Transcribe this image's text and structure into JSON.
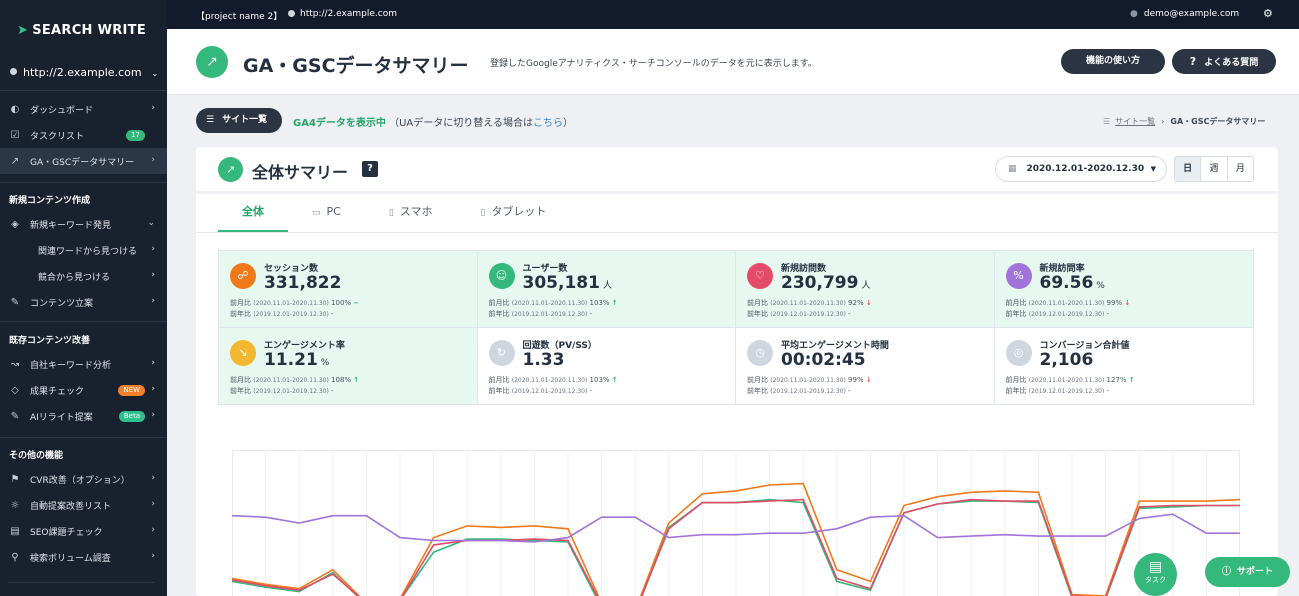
{
  "app": {
    "logo": "SEARCH WRITE",
    "site": "http://2.example.com"
  },
  "topbar": {
    "project": "【project name 2】",
    "url": "http://2.example.com",
    "user": "demo@example.com"
  },
  "sidebar": {
    "items_top": [
      {
        "label": "ダッシュボード",
        "icon": "gauge-icon"
      },
      {
        "label": "タスクリスト",
        "icon": "checkbox-icon",
        "badge": "17"
      },
      {
        "label": "GA・GSCデータサマリー",
        "icon": "chart-line-icon",
        "active": true
      }
    ],
    "sec_new": "新規コンテンツ作成",
    "new_items": [
      {
        "label": "新規キーワード発見"
      },
      {
        "label": "関連ワードから見つける"
      },
      {
        "label": "競合から見つける"
      },
      {
        "label": "コンテンツ立案"
      }
    ],
    "sec_existing": "既存コンテンツ改善",
    "existing_items": [
      {
        "label": "自社キーワード分析"
      },
      {
        "label": "成果チェック",
        "badge": "NEW"
      },
      {
        "label": "AIリライト提案",
        "badge": "Beta"
      }
    ],
    "sec_other": "その他の機能",
    "other_items": [
      {
        "label": "CVR改善（オプション）"
      },
      {
        "label": "自動提案改善リスト"
      },
      {
        "label": "SEO課題チェック"
      },
      {
        "label": "検索ボリューム調査"
      }
    ]
  },
  "header": {
    "title": "GA・GSCデータサマリー",
    "desc": "登録したGoogleアナリティクス・サーチコンソールのデータを元に表示します。",
    "btn_usage": "機能の使い方",
    "btn_faq": "よくある質問"
  },
  "toolbar": {
    "site_list": "サイト一覧",
    "ga4_on": "GA4データを表示中",
    "ga4_note_pre": "（UAデータに切り替える場合は",
    "ga4_link": "こちら",
    "ga4_note_post": "）",
    "crumb_link": "サイト一覧",
    "crumb_sep": "›",
    "crumb_current": "GA・GSCデータサマリー"
  },
  "summary": {
    "title": "全体サマリー",
    "help": "?",
    "date_range": "2020.12.01-2020.12.30",
    "periods": [
      "日",
      "週",
      "月"
    ],
    "tabs": [
      "全体",
      "PC",
      "スマホ",
      "タブレット"
    ]
  },
  "metrics": [
    {
      "label": "セッション数",
      "value": "331,822",
      "unit": "",
      "mom_label": "前月比",
      "mom_range": "(2020.11.01-2020.11.30)",
      "mom_pct": "100%",
      "mom_dir": "flat",
      "yoy_label": "前年比",
      "yoy_range": "(2019.12.01-2019.12.30)",
      "yoy_val": "-",
      "color": "#f07a1a",
      "icon": "share-icon",
      "hl": true
    },
    {
      "label": "ユーザー数",
      "value": "305,181",
      "unit": "人",
      "mom_label": "前月比",
      "mom_range": "(2020.11.01-2020.11.30)",
      "mom_pct": "103%",
      "mom_dir": "up",
      "yoy_label": "前年比",
      "yoy_range": "(2019.12.01-2019.12.30)",
      "yoy_val": "-",
      "color": "#35b87b",
      "icon": "user-icon",
      "hl": true
    },
    {
      "label": "新規訪問数",
      "value": "230,799",
      "unit": "人",
      "mom_label": "前月比",
      "mom_range": "(2020.11.01-2020.11.30)",
      "mom_pct": "92%",
      "mom_dir": "down",
      "yoy_label": "前年比",
      "yoy_range": "(2019.12.01-2019.12.30)",
      "yoy_val": "-",
      "color": "#e34b68",
      "icon": "heart-icon",
      "hl": true
    },
    {
      "label": "新規訪問率",
      "value": "69.56",
      "unit": "%",
      "mom_label": "前月比",
      "mom_range": "(2020.11.01-2020.11.30)",
      "mom_pct": "99%",
      "mom_dir": "down",
      "yoy_label": "前年比",
      "yoy_range": "(2019.12.01-2019.12.30)",
      "yoy_val": "-",
      "color": "#a273d8",
      "icon": "percent-icon",
      "hl": true
    },
    {
      "label": "エンゲージメント率",
      "value": "11.21",
      "unit": "%",
      "mom_label": "前月比",
      "mom_range": "(2020.11.01-2020.11.30)",
      "mom_pct": "108%",
      "mom_dir": "up",
      "yoy_label": "前年比",
      "yoy_range": "(2019.12.01-2019.12.30)",
      "yoy_val": "-",
      "color": "#f1b830",
      "icon": "trend-icon",
      "hl": true
    },
    {
      "label": "回遊数（PV/SS）",
      "value": "1.33",
      "unit": "",
      "mom_label": "前月比",
      "mom_range": "(2020.11.01-2020.11.30)",
      "mom_pct": "103%",
      "mom_dir": "up",
      "yoy_label": "前年比",
      "yoy_range": "(2019.12.01-2019.12.30)",
      "yoy_val": "-",
      "color": "#cfd6de",
      "icon": "refresh-icon",
      "hl": false
    },
    {
      "label": "平均エンゲージメント時間",
      "value": "00:02:45",
      "unit": "",
      "mom_label": "前月比",
      "mom_range": "(2020.11.01-2020.11.30)",
      "mom_pct": "99%",
      "mom_dir": "down",
      "yoy_label": "前年比",
      "yoy_range": "(2019.12.01-2019.12.30)",
      "yoy_val": "-",
      "color": "#cfd6de",
      "icon": "clock-icon",
      "hl": false
    },
    {
      "label": "コンバージョン合計値",
      "value": "2,106",
      "unit": "",
      "mom_label": "前月比",
      "mom_range": "(2020.11.01-2020.11.30)",
      "mom_pct": "127%",
      "mom_dir": "up",
      "yoy_label": "前年比",
      "yoy_range": "(2019.12.01-2019.12.30)",
      "yoy_val": "-",
      "color": "#cfd6de",
      "icon": "target-icon",
      "hl": false
    }
  ],
  "chart_data": {
    "type": "line",
    "ylim": [
      0,
      100
    ],
    "grid": true,
    "series": [
      {
        "color": "#f07a1a",
        "values": [
          12,
          8,
          5,
          18,
          -5,
          -2,
          40,
          48,
          47,
          48,
          46,
          -5,
          -10,
          50,
          70,
          72,
          76,
          77,
          18,
          10,
          62,
          68,
          71,
          72,
          71,
          1,
          0,
          65,
          65,
          65,
          66
        ]
      },
      {
        "color": "#35b87b",
        "values": [
          10,
          6,
          3,
          16,
          -6,
          -3,
          30,
          39,
          39,
          38,
          37,
          -8,
          -12,
          47,
          64,
          64,
          66,
          64,
          10,
          4,
          57,
          63,
          65,
          65,
          64,
          -1,
          -2,
          60,
          61,
          62,
          62
        ]
      },
      {
        "color": "#e34b68",
        "values": [
          11,
          7,
          4,
          15,
          -5,
          -3,
          35,
          38,
          38,
          39,
          38,
          -6,
          -11,
          46,
          64,
          64,
          65,
          66,
          12,
          5,
          57,
          63,
          66,
          65,
          65,
          0,
          -1,
          61,
          62,
          62,
          62
        ]
      },
      {
        "color": "#a273d8",
        "values": [
          55,
          54,
          50,
          55,
          55,
          40,
          38,
          38,
          38,
          37,
          40,
          54,
          54,
          40,
          42,
          42,
          43,
          43,
          46,
          54,
          55,
          40,
          41,
          42,
          41,
          41,
          41,
          53,
          56,
          43,
          43
        ]
      }
    ]
  },
  "fab": {
    "task": "タスク",
    "support": "サポート"
  }
}
